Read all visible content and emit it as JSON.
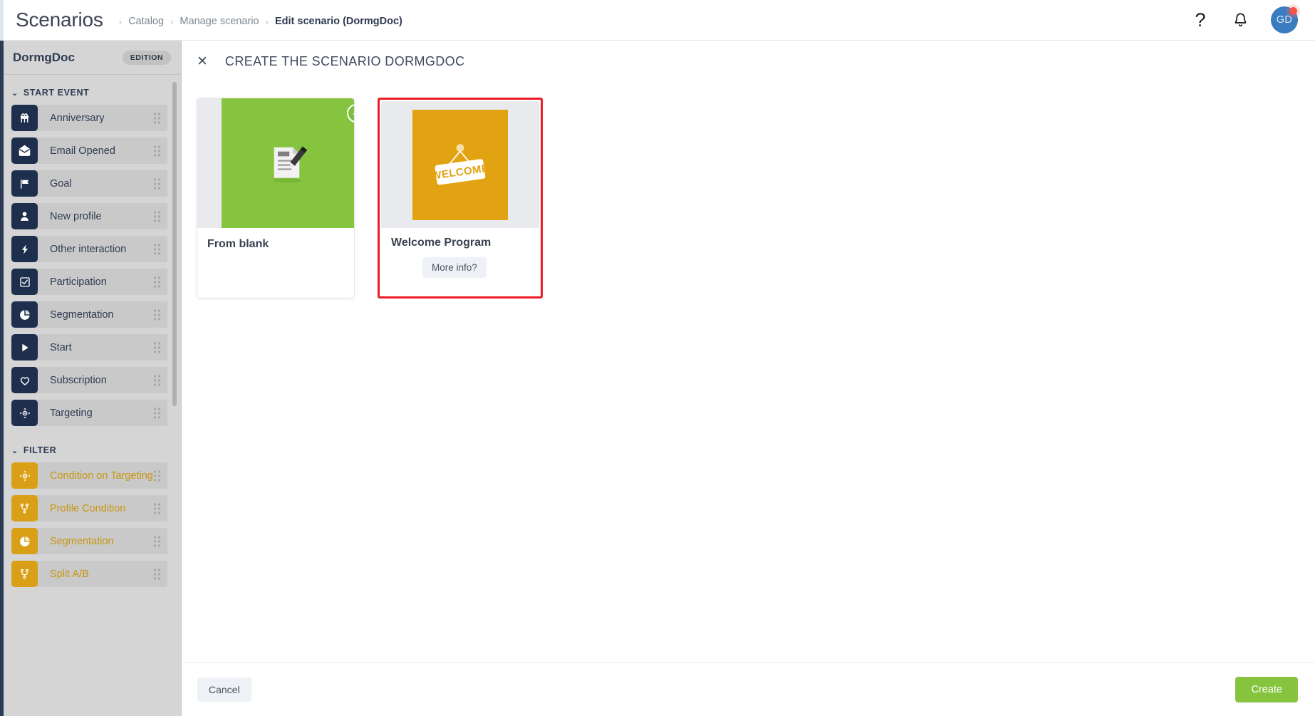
{
  "topbar": {
    "app_title": "Scenarios",
    "breadcrumb": [
      {
        "label": "Catalog",
        "active": false
      },
      {
        "label": "Manage scenario",
        "active": false
      },
      {
        "label": "Edit scenario (DormgDoc)",
        "active": true
      }
    ],
    "separator": "›",
    "help_icon": "help-question-icon",
    "help_glyph": "?",
    "bell_icon": "notification-bell-icon",
    "avatar_initials": "GD",
    "avatar_color": "#3b7cc0",
    "notification_dot_color": "#f4554a"
  },
  "sidebar": {
    "title": "DormgDoc",
    "edition_badge": "EDITION",
    "sections": [
      {
        "label": "START EVENT",
        "collapse_chevron": "chevron-down-icon",
        "item_color": "#1e2f4d",
        "items": [
          {
            "label": "Anniversary",
            "icon": "gift-icon"
          },
          {
            "label": "Email Opened",
            "icon": "envelope-icon"
          },
          {
            "label": "Goal",
            "icon": "flag-icon"
          },
          {
            "label": "New profile",
            "icon": "person-icon"
          },
          {
            "label": "Other interaction",
            "icon": "lightning-bolt-icon"
          },
          {
            "label": "Participation",
            "icon": "checkbox-icon"
          },
          {
            "label": "Segmentation",
            "icon": "pie-chart-icon"
          },
          {
            "label": "Start",
            "icon": "play-triangle-icon"
          },
          {
            "label": "Subscription",
            "icon": "heart-icon"
          },
          {
            "label": "Targeting",
            "icon": "crosshair-target-icon"
          }
        ]
      },
      {
        "label": "FILTER",
        "collapse_chevron": "chevron-down-icon",
        "item_color": "#d9a017",
        "items": [
          {
            "label": "Condition on Targeting",
            "icon": "crosshair-target-icon"
          },
          {
            "label": "Profile Condition",
            "icon": "branch-fork-icon"
          },
          {
            "label": "Segmentation",
            "icon": "pie-chart-icon"
          },
          {
            "label": "Split A/B",
            "icon": "branch-fork-icon"
          }
        ]
      }
    ]
  },
  "panel": {
    "close_icon": "close-x-icon",
    "title": "CREATE THE SCENARIO DORMGDOC",
    "cards": [
      {
        "name": "From blank",
        "illustration": "document-pencil-icon",
        "media_color": "#86c440",
        "selected": true,
        "check_icon": "check-circle-icon",
        "has_more_info": false
      },
      {
        "name": "Welcome Program",
        "illustration": "welcome-sign-icon",
        "media_color": "#e2a312",
        "sign_text": "WELCOME",
        "selected": false,
        "highlighted": true,
        "highlight_color": "#ed1c24",
        "has_more_info": true,
        "more_info_label": "More info?"
      }
    ]
  },
  "footer": {
    "cancel_label": "Cancel",
    "create_label": "Create",
    "create_color": "#86c440"
  }
}
